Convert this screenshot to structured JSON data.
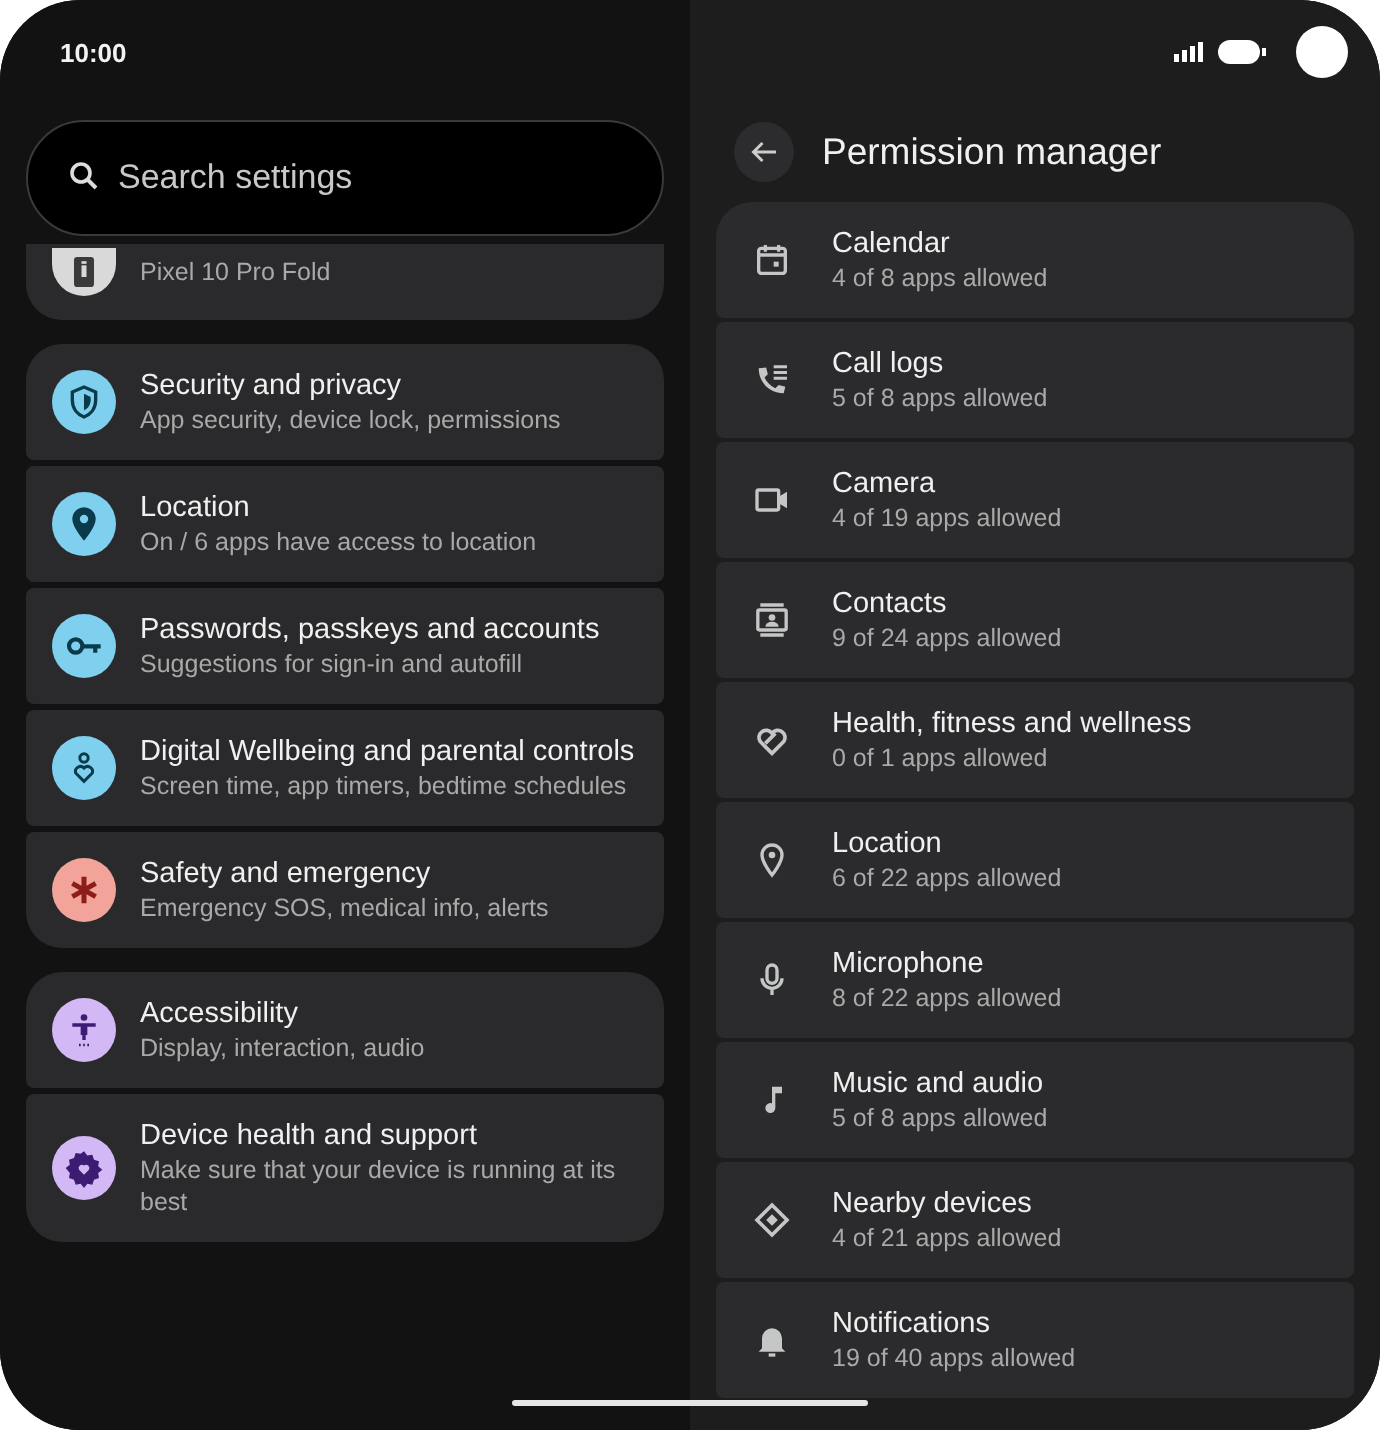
{
  "status_bar": {
    "time": "10:00"
  },
  "search": {
    "placeholder": "Search settings"
  },
  "settings_groups": [
    {
      "items": [
        {
          "subtitle": "Pixel 10 Pro Fold",
          "color": "#d9d9d9",
          "cut": true
        }
      ]
    },
    {
      "items": [
        {
          "title": "Security and privacy",
          "subtitle": "App security, device lock, permissions",
          "color": "#7fcfef"
        },
        {
          "title": "Location",
          "subtitle": "On / 6 apps have access to location",
          "color": "#7fcfef"
        },
        {
          "title": "Passwords, passkeys and accounts",
          "subtitle": "Suggestions for sign-in and autofill",
          "color": "#7fcfef"
        },
        {
          "title": "Digital Wellbeing and parental controls",
          "subtitle": "Screen time, app timers, bedtime schedules",
          "color": "#7fcfef"
        },
        {
          "title": "Safety and emergency",
          "subtitle": "Emergency SOS, medical info, alerts",
          "color": "#f2a49b"
        }
      ]
    },
    {
      "items": [
        {
          "title": "Accessibility",
          "subtitle": "Display, interaction, audio",
          "color": "#d3b8f6"
        },
        {
          "title": "Device health and support",
          "subtitle": "Make sure that your device is running at its best",
          "color": "#d3b8f6"
        }
      ]
    }
  ],
  "permission_manager": {
    "title": "Permission manager",
    "items": [
      {
        "title": "Calendar",
        "subtitle": "4 of 8 apps allowed"
      },
      {
        "title": "Call logs",
        "subtitle": "5 of 8 apps allowed"
      },
      {
        "title": "Camera",
        "subtitle": "4 of 19 apps allowed"
      },
      {
        "title": "Contacts",
        "subtitle": "9 of 24 apps allowed"
      },
      {
        "title": "Health, fitness and wellness",
        "subtitle": "0 of 1 apps allowed"
      },
      {
        "title": "Location",
        "subtitle": "6 of 22 apps allowed"
      },
      {
        "title": "Microphone",
        "subtitle": "8 of 22 apps allowed"
      },
      {
        "title": "Music and audio",
        "subtitle": "5 of 8 apps allowed"
      },
      {
        "title": "Nearby devices",
        "subtitle": "4 of 21 apps allowed"
      },
      {
        "title": "Notifications",
        "subtitle": "19 of 40 apps allowed"
      }
    ]
  }
}
